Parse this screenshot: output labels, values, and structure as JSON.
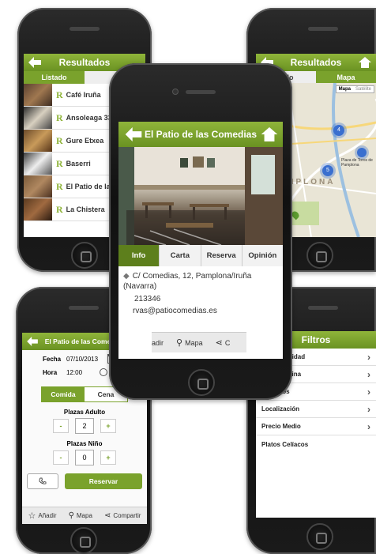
{
  "phone_list": {
    "title": "Resultados",
    "tab_list": "Listado",
    "items": [
      {
        "name": "Café Iruña"
      },
      {
        "name": "Ansoleaga 33"
      },
      {
        "name": "Gure Etxea"
      },
      {
        "name": "Baserri"
      },
      {
        "name": "El Patio de las"
      },
      {
        "name": "La Chistera"
      }
    ],
    "item_prefix": "R"
  },
  "phone_map": {
    "title": "Resultados",
    "tab_list": "tado",
    "tab_map": "Mapa",
    "map_btn_map": "Mapa",
    "map_btn_sat": "Satélite",
    "city_label": "PAMPLONA",
    "plaza_label": "Plaza de Toros de Pamplona",
    "cluster_a": "4",
    "cluster_b": "5"
  },
  "phone_detail": {
    "title": "El Patio de las Comedias",
    "tabs": [
      "Info",
      "Carta",
      "Reserva",
      "Opinión"
    ],
    "address_line1": "C/ Comedias, 12, Pamplona/Iruña",
    "address_line2": "(Navarra)",
    "phone": "213346",
    "email": "rvas@patiocomedias.es",
    "bar_add": "adir",
    "bar_map": "Mapa",
    "bar_share": "C"
  },
  "phone_reserve": {
    "title": "El Patio de las Comedias",
    "fecha_label": "Fecha",
    "fecha_value": "07/10/2013",
    "cal_day": "7",
    "hora_label": "Hora",
    "hora_value": "12:00",
    "meal_comida": "Comida",
    "meal_cena": "Cena",
    "adultos_label": "Plazas Adulto",
    "adultos_value": "2",
    "ninos_label": "Plazas Niño",
    "ninos_value": "0",
    "minus": "-",
    "plus": "+",
    "reservar": "Reservar",
    "bar_add": "Añadir",
    "bar_map": "Mapa",
    "bar_share": "Compartir"
  },
  "phone_filters": {
    "title": "Filtros",
    "items": [
      {
        "label": "Disponibilidad"
      },
      {
        "label": "Tipos Cocina"
      },
      {
        "label": "Servicios"
      },
      {
        "label": "Localización"
      },
      {
        "label": "Precio Medio"
      },
      {
        "label": "Platos Celíacos"
      }
    ]
  },
  "colors": {
    "accent": "#7aa22c",
    "accent_dark": "#5d7f1c"
  }
}
